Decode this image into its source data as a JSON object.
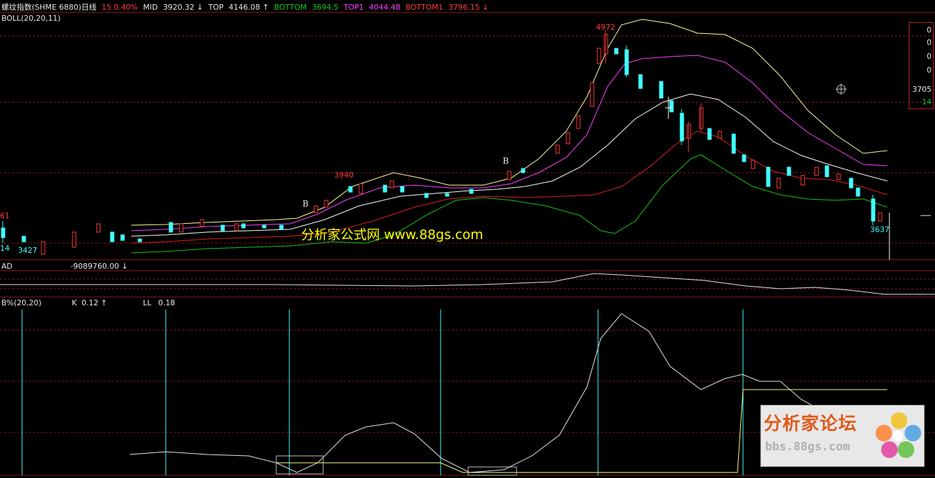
{
  "header": {
    "title": "螺纹指数(SHME 6880)日线",
    "pct": "15 0.40%",
    "mid_label": "MID",
    "mid_value": "3920.32 ↓",
    "top_label": "TOP",
    "top_value": "4146.08 ↑",
    "bottom_label": "BOTTOM",
    "bottom_value": "3694.5",
    "top1_label": "TOP1",
    "top1_value": "4044.48",
    "bottom1_label": "BOTTOM1",
    "bottom1_value": "3796.15 ↓"
  },
  "boll_label": "BOLL(20,20,11)",
  "price_labels": {
    "left_top": "61",
    "left_low_a": "14",
    "left_low_b": "3427",
    "peak1": "3940",
    "peak2": "4972",
    "low_right": "3637",
    "signal_b1": "B",
    "signal_b2": "B"
  },
  "watermark": "分析家公式网  www.88gs.com",
  "ad_panel": {
    "label": "AD",
    "value": "-9089760.00 ↓"
  },
  "b_panel": {
    "label": "B%(20,20)",
    "k_label": "K",
    "k_value": "0.12 ↑",
    "ll_label": "LL",
    "ll_value": "0.18"
  },
  "right_box": {
    "r1": "0",
    "r2": "0",
    "r3": "0",
    "r4": "0",
    "r5": "3705",
    "r6": "14"
  },
  "forum_logo": {
    "title": "分析家论坛",
    "url": "bbs.88gs.com"
  },
  "colors": {
    "background": "#000000",
    "up": "#ff3c3c",
    "down": "#40ffff",
    "mid": "#ffffff",
    "top": "#ffff80",
    "bottom": "#18c818",
    "top1": "#ff40ff",
    "bottom1": "#ff2020",
    "grid": "#8b1a1a"
  }
}
